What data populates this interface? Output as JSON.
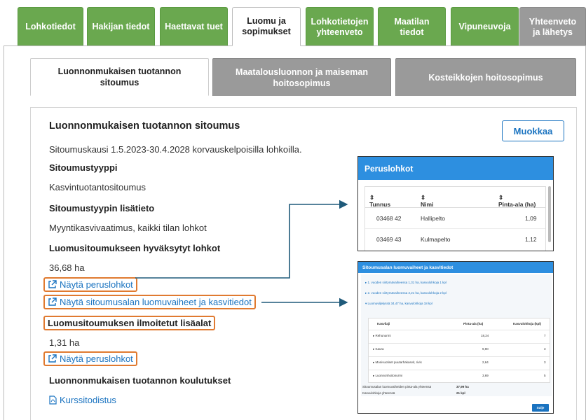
{
  "top_tabs": [
    {
      "label": "Lohkotiedot"
    },
    {
      "label": "Hakijan tiedot"
    },
    {
      "label": "Haettavat tuet"
    },
    {
      "label": "Luomu ja sopimukset"
    },
    {
      "label": "Lohkotietojen yhteenveto"
    },
    {
      "label": "Maatilan tiedot"
    },
    {
      "label": "Vipuneuvoja"
    },
    {
      "label": "Yhteenveto ja lähetys"
    }
  ],
  "sub_tabs": [
    {
      "label": "Luonnonmukaisen tuotannon sitoumus"
    },
    {
      "label": "Maatalousluonnon ja maiseman hoitosopimus"
    },
    {
      "label": "Kosteikkojen hoitosopimus"
    }
  ],
  "card": {
    "title": "Luonnonmukaisen tuotannon sitoumus",
    "edit_button": "Muokkaa",
    "period": "Sitoumuskausi 1.5.2023-30.4.2028 korvauskelpoisilla lohkoilla.",
    "type_heading": "Sitoumustyyppi",
    "type_value": "Kasvintuotantositoumus",
    "extra_heading": "Sitoumustyypin lisätieto",
    "extra_value": "Myyntikasvivaatimus, kaikki tilan lohkot",
    "approved_heading": "Luomusitoumukseen hyväksytyt lohkot",
    "approved_value": "36,68 ha",
    "link_show_parcels": "Näytä peruslohkot",
    "link_show_phases": "Näytä sitoumusalan luomuvaiheet ja kasvitiedot",
    "additional_heading": "Luomusitoumuksen ilmoitetut lisäalat",
    "additional_value": "1,31 ha",
    "link_show_parcels_2": "Näytä peruslohkot",
    "training_heading": "Luonnonmukaisen tuotannon koulutukset",
    "certificate_link": "Kurssitodistus"
  },
  "peruslohkot": {
    "title": "Peruslohkot",
    "columns": [
      "Tunnus",
      "Nimi",
      "Pinta-ala (ha)"
    ],
    "rows": [
      {
        "tunnus": "03468 42",
        "nimi": "Hallipelto",
        "ala": "1,09"
      },
      {
        "tunnus": "03469 43",
        "nimi": "Kulmapelto",
        "ala": "1,12"
      }
    ]
  },
  "luomuvaiheet": {
    "title": "Sitoumusalan luomuvaiheet ja kasvitiedot",
    "phases": [
      "▸ 1. vuoden siirtymävaiheessa 1,31 ha, kasvulohkoja 1 kpl",
      "▸ 2. vuoden siirtymävaiheessa 2,21 ha, kasvulohkoja 2 kpl",
      "▾ Luomuviljelyssä 34,47 ha, kasvulohkoja 18 kpl"
    ],
    "columns": [
      "Kasvilaji",
      "Pinta-ala (ha)",
      "Kasvulohkoja (kpl)"
    ],
    "rows": [
      {
        "laji": "Rehunurmi",
        "ala": "18,24",
        "kpl": "7"
      },
      {
        "laji": "Kaura",
        "ala": "9,90",
        "kpl": "3"
      },
      {
        "laji": "Monivuotiset puutarhakasvit, rivis",
        "ala": "2,64",
        "kpl": "3"
      },
      {
        "laji": "Luonnonhoitonurmi",
        "ala": "3,69",
        "kpl": "5"
      }
    ],
    "total_area_label": "Sitoumusalan luomuvaiheiden pinta-ala yhteensä",
    "total_area_value": "37,99 ha",
    "total_count_label": "Kasvulohkoja yhteensä",
    "total_count_value": "21 kpl",
    "close_button": "Sulje"
  },
  "colors": {
    "tab_green": "#6aa84f",
    "tab_grey": "#9a9a9a",
    "link_blue": "#1a73c0",
    "highlight_orange": "#e07a30",
    "arrow_navy": "#1f5a7a",
    "header_blue": "#2d8fe0"
  }
}
